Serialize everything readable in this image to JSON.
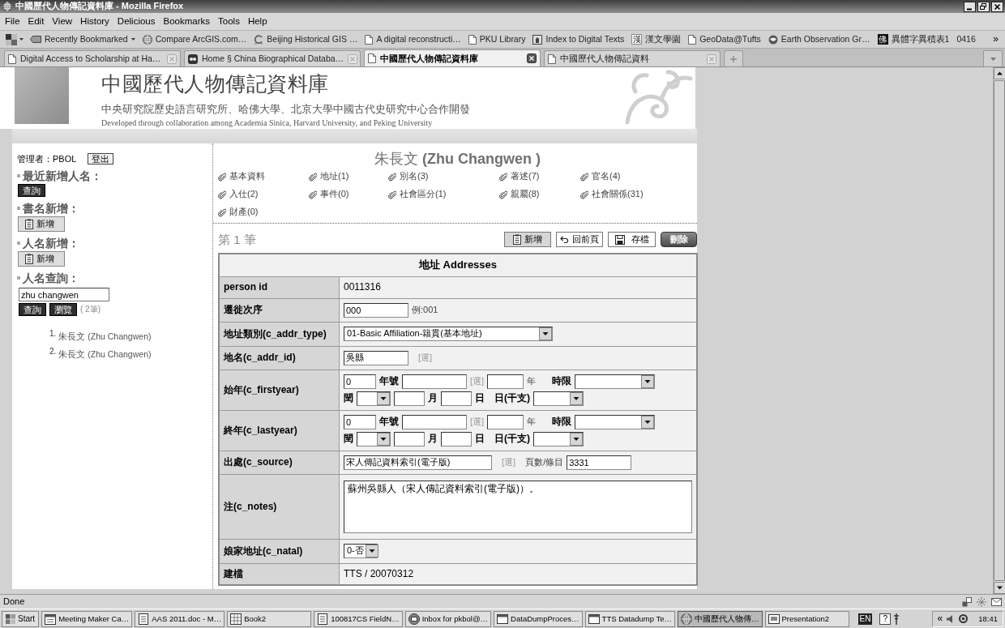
{
  "window": {
    "title": "中國歷代人物傳記資料庫 - Mozilla Firefox"
  },
  "menu": [
    "File",
    "Edit",
    "View",
    "History",
    "Delicious",
    "Bookmarks",
    "Tools",
    "Help"
  ],
  "bookmarks": {
    "items": [
      {
        "label": "Recently Bookmarked",
        "kind": "folder"
      },
      {
        "label": "Compare ArcGIS.com…",
        "kind": "globe"
      },
      {
        "label": "Beijing Historical GIS …",
        "kind": "swirl"
      },
      {
        "label": "A digital reconstructi…",
        "kind": "page"
      },
      {
        "label": "PKU Library",
        "kind": "page"
      },
      {
        "label": "Index to Digital Texts",
        "kind": "framed"
      },
      {
        "label": "漢文學園",
        "kind": "glyph",
        "glyph": "漢"
      },
      {
        "label": "GeoData@Tufts",
        "kind": "page"
      },
      {
        "label": "Earth Observation Gr…",
        "kind": "emblem"
      },
      {
        "label": "異體字異積表1",
        "kind": "stamp",
        "glyph": "佛"
      },
      {
        "label": "0416",
        "kind": "plain"
      }
    ],
    "overflow": "»"
  },
  "tabs": [
    {
      "label": "Digital Access to Scholarship at Ha…",
      "kind": "page",
      "selected": false
    },
    {
      "label": "Home § China Biographical Databa…",
      "kind": "mask",
      "selected": false
    },
    {
      "label": "中國歷代人物傳記資料庫",
      "kind": "page",
      "selected": true
    },
    {
      "label": "中國歷代人物傳記資料",
      "kind": "page",
      "selected": false
    }
  ],
  "site_header": {
    "title": "中國歷代人物傳記資料庫",
    "subtitle": "中央研究院歷史語言研究所、哈佛大學、北京大學中國古代史研究中心合作開發",
    "subtitle_en": "Developed through collaboration among Academia Sinica, Harvard University, and Peking University"
  },
  "sidebar": {
    "admin": "管理者：PBOL",
    "logout": "登出",
    "sections": [
      {
        "heading": "最近新增人名：",
        "kind": "query",
        "button": "查詢"
      },
      {
        "heading": "書名新增：",
        "kind": "add",
        "button": "新增"
      },
      {
        "heading": "人名新增：",
        "kind": "add",
        "button": "新增"
      },
      {
        "heading": "人名查詢：",
        "kind": "search",
        "value": "zhu changwen",
        "buttons": [
          "查詢",
          "瀏覽"
        ],
        "count": "( 2筆)"
      }
    ],
    "results": [
      {
        "number": "1.",
        "name": "朱長文 (Zhu Changwen)"
      },
      {
        "number": "2.",
        "name": "朱長文 (Zhu Changwen)"
      }
    ]
  },
  "person": {
    "heading": "朱長文 **(Zhu Changwen )**",
    "links": [
      "基本資料",
      "地址(1)",
      "別名(3)",
      "著述(7)",
      "官名(4)",
      "入仕(2)",
      "事件(0)",
      "社會區分(1)",
      "親屬(8)",
      "社會關係(31)",
      "財產(0)"
    ],
    "record": "第 1 筆",
    "actions": [
      {
        "label": "新增",
        "kind": "add"
      },
      {
        "label": "回前頁",
        "kind": "back"
      },
      {
        "label": "存檔",
        "kind": "save"
      },
      {
        "label": "刪除",
        "kind": "delete"
      }
    ]
  },
  "form": {
    "title": "地址 Addresses",
    "rows": [
      {
        "label": "person id",
        "kind": "text",
        "value": "0011316"
      },
      {
        "label": "遷徙次序",
        "kind": "input",
        "value": "000",
        "hint": "例:001"
      },
      {
        "label": "地址類別(c_addr_type)",
        "kind": "select",
        "value": "01-Basic Affiliation-籍貫(基本地址)"
      },
      {
        "label": "地名(c_addr_id)",
        "kind": "input",
        "value": "吳縣",
        "pick": "[選]"
      },
      {
        "label": "始年(c_firstyear)",
        "kind": "date",
        "year": "0",
        "era": "年號",
        "pick": "[選]",
        "year_unit": "年",
        "range": "時限",
        "leap": "閏",
        "month": "月",
        "day": "日",
        "ganzhi": "日(干支)"
      },
      {
        "label": "終年(c_lastyear)",
        "kind": "date",
        "year": "0",
        "era": "年號",
        "pick": "[選]",
        "year_unit": "年",
        "range": "時限",
        "leap": "閏",
        "month": "月",
        "day": "日",
        "ganzhi": "日(干支)"
      },
      {
        "label": "出處(c_source)",
        "kind": "source",
        "value": "宋人傳記資料索引(電子版)",
        "pick": "[選]",
        "page_label": "頁數/條目",
        "page_value": "3331"
      },
      {
        "label": "注(c_notes)",
        "kind": "textarea",
        "value": "蘇州吳縣人（宋人傳記資料索引(電子版)）。"
      },
      {
        "label": "娘家地址(c_natal)",
        "kind": "smallselect",
        "value": "0-否"
      },
      {
        "label": "建檔",
        "kind": "text",
        "value": "TTS / 20070312"
      }
    ]
  },
  "status_bar": {
    "text": "Done"
  },
  "taskbar": {
    "start": "Start",
    "items": [
      {
        "label": "Meeting Maker Ca…",
        "kind": "calendar",
        "selected": false
      },
      {
        "label": "AAS 2011.doc - M…",
        "kind": "doc",
        "selected": false
      },
      {
        "label": "Book2",
        "kind": "sheet",
        "selected": false
      },
      {
        "label": "100817CS FieldN…",
        "kind": "doc",
        "selected": false
      },
      {
        "label": "Inbox for pkbol@…",
        "kind": "mail",
        "selected": false
      },
      {
        "label": "DataDumpProces…",
        "kind": "window",
        "selected": false
      },
      {
        "label": "TTS Datadump Te…",
        "kind": "window",
        "selected": false
      },
      {
        "label": "中國歷代人物傳…",
        "kind": "browser",
        "selected": true
      },
      {
        "label": "Presentation2",
        "kind": "slides",
        "selected": false
      }
    ],
    "language": "EN",
    "help": "?",
    "expand": "«",
    "clock": "18:41"
  }
}
